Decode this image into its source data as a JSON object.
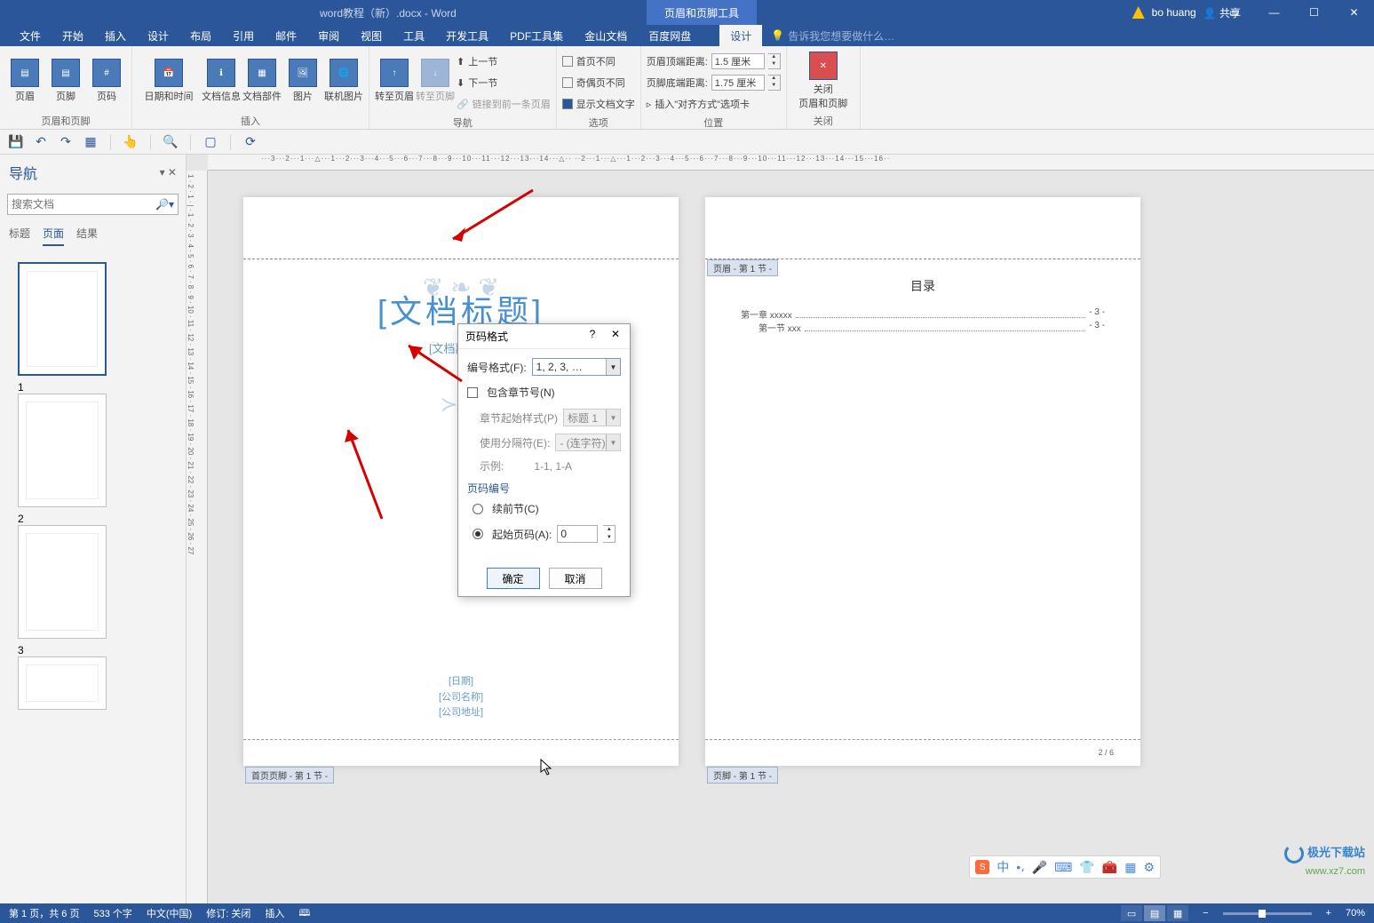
{
  "titlebar": {
    "doc_title": "word教程（新）.docx - Word",
    "context_tab": "页眉和页脚工具",
    "user_name": "bo huang",
    "share": "共享"
  },
  "menu": {
    "tabs": [
      "文件",
      "开始",
      "插入",
      "设计",
      "布局",
      "引用",
      "邮件",
      "审阅",
      "视图",
      "工具",
      "开发工具",
      "PDF工具集",
      "金山文档",
      "百度网盘"
    ],
    "design_tab": "设计",
    "tellme_placeholder": "告诉我您想要做什么…"
  },
  "ribbon": {
    "g1": {
      "label": "页眉和页脚",
      "b1": "页眉",
      "b2": "页脚",
      "b3": "页码"
    },
    "g2": {
      "label": "插入",
      "b1": "日期和时间",
      "b2": "文档信息",
      "b3": "文档部件",
      "b4": "图片",
      "b5": "联机图片"
    },
    "g3": {
      "label": "导航",
      "b1": "转至页眉",
      "b2": "转至页脚",
      "r1": "上一节",
      "r2": "下一节",
      "r3": "链接到前一条页眉"
    },
    "g4": {
      "label": "选项",
      "r1": "首页不同",
      "r2": "奇偶页不同",
      "r3": "显示文档文字"
    },
    "g5": {
      "label": "位置",
      "r1": "页眉顶端距离:",
      "r1v": "1.5 厘米",
      "r2": "页脚底端距离:",
      "r2v": "1.75 厘米",
      "r3": "插入\"对齐方式\"选项卡"
    },
    "g6": {
      "label": "关闭",
      "b1": "关闭\n页眉和页脚"
    }
  },
  "nav": {
    "title": "导航",
    "search_placeholder": "搜索文档",
    "tabs": [
      "标题",
      "页面",
      "结果"
    ],
    "thumb_nums": [
      "1",
      "2",
      "3"
    ]
  },
  "dialog": {
    "title": "页码格式",
    "fmt_label": "编号格式(F):",
    "fmt_value": "1, 2, 3, …",
    "include_chapter": "包含章节号(N)",
    "chapter_start": "章节起始样式(P)",
    "chapter_start_v": "标题 1",
    "separator": "使用分隔符(E):",
    "separator_v": "-   (连字符)",
    "example_label": "示例:",
    "example_v": "1-1, 1-A",
    "section": "页码编号",
    "continue": "续前节(C)",
    "start_at": "起始页码(A):",
    "start_at_v": "0",
    "ok": "确定",
    "cancel": "取消"
  },
  "page1": {
    "hf_footer_tag": "首页页脚 - 第 1 节 -",
    "title": "[文档标题]",
    "subtitle": "[文档副标题]",
    "date": "[日期]",
    "company": "[公司名称]",
    "address": "[公司地址]"
  },
  "page2": {
    "hf_header_tag": "页眉 - 第 1 节 -",
    "hf_footer_tag": "页脚 - 第 1 节 -",
    "toc_title": "目录",
    "toc1_l": "第一章  xxxxx",
    "toc1_p": "- 3 -",
    "toc2_l": "第一节  xxx",
    "toc2_p": "- 3 -",
    "page_num": "2 / 6"
  },
  "status": {
    "page": "第 1 页，共 6 页",
    "words": "533 个字",
    "lang": "中文(中国)",
    "track": "修订: 关闭",
    "insert": "插入",
    "zoom": "70%"
  },
  "ime": {
    "zhong": "中"
  },
  "watermark": {
    "brand": "极光下载站",
    "url": "www.xz7.com"
  },
  "ruler_h": "···3···2···1···△···1···2···3···4···5···6···7···8···9···10···11···12···13···14···△··                                    ··2···1···△···1···2···3···4···5···6···7···8···9···10···11···12···13···14···15···16··",
  "ruler_v": "1 · 2 · 1 · | · 1 · 2 · 3 · 4 · 5 · 6 · 7 · 8 · 9 · 10 · 11 · 12 · 13 · 14 · 15 · 16 · 17 · 18 · 19 · 20 · 21 · 22 · 23 · 24 · 25 · 26 · 27"
}
